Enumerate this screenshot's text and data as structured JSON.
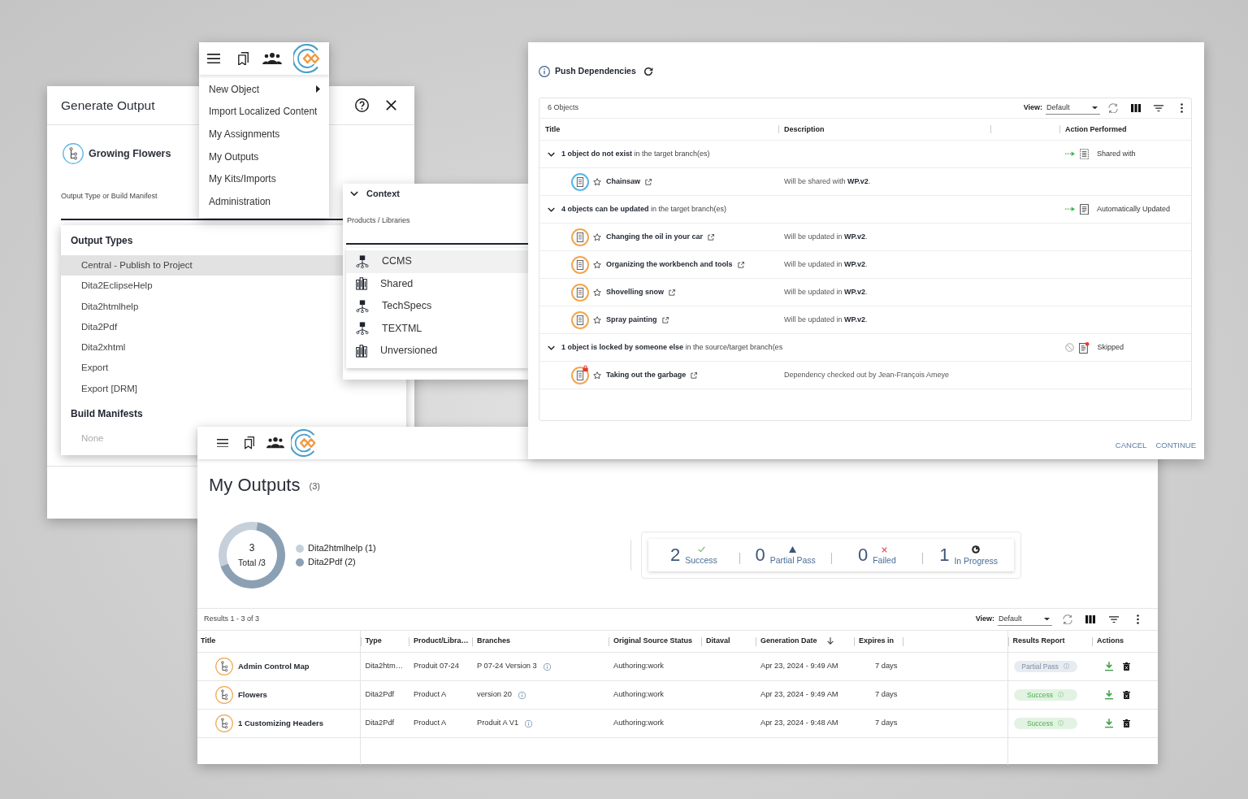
{
  "generate_output": {
    "title": "Generate Output",
    "object_title": "Growing Flowers",
    "field_label": "Output Type or Build Manifest",
    "sections": [
      {
        "heading": "Output Types",
        "items": [
          {
            "label": "Central - Publish to Project",
            "selected": true,
            "disabled": false
          },
          {
            "label": "Dita2EclipseHelp",
            "selected": false,
            "disabled": false
          },
          {
            "label": "Dita2htmlhelp",
            "selected": false,
            "disabled": false
          },
          {
            "label": "Dita2Pdf",
            "selected": false,
            "disabled": false
          },
          {
            "label": "Dita2xhtml",
            "selected": false,
            "disabled": false
          },
          {
            "label": "Export",
            "selected": false,
            "disabled": false
          },
          {
            "label": "Export [DRM]",
            "selected": false,
            "disabled": false
          }
        ]
      },
      {
        "heading": "Build Manifests",
        "items": [
          {
            "label": "None",
            "selected": false,
            "disabled": true
          }
        ]
      }
    ]
  },
  "main_menu": {
    "items": [
      {
        "label": "New Object",
        "submenu": true
      },
      {
        "label": "Import Localized Content",
        "submenu": false
      },
      {
        "label": "My Assignments",
        "submenu": false
      },
      {
        "label": "My Outputs",
        "submenu": false
      },
      {
        "label": "My Kits/Imports",
        "submenu": false
      },
      {
        "label": "Administration",
        "submenu": false
      }
    ]
  },
  "context_panel": {
    "title": "Context",
    "expanded": true,
    "field_label": "Products / Libraries",
    "items": [
      {
        "label": "CCMS",
        "kind": "product",
        "selected": true
      },
      {
        "label": "Shared",
        "kind": "library",
        "selected": false
      },
      {
        "label": "TechSpecs",
        "kind": "product",
        "selected": false
      },
      {
        "label": "TEXTML",
        "kind": "product",
        "selected": false
      },
      {
        "label": "Unversioned",
        "kind": "library",
        "selected": false
      }
    ]
  },
  "push_dependencies": {
    "title": "Push Dependencies",
    "count_label": "6 Objects",
    "view_label": "View:",
    "view_value": "Default",
    "columns": [
      "Title",
      "Description",
      "Action Performed"
    ],
    "groups": [
      {
        "heading": "**1 object do not exist** in the target branch(es)",
        "expanded": true,
        "kind": "shared",
        "action": "Shared with",
        "items": [
          {
            "title": "Chainsaw",
            "description": "Will be shared with **WP.v2**.",
            "color": "#5bb5e6",
            "locked": false
          }
        ]
      },
      {
        "heading": "**4 objects can be updated** in the target branch(es)",
        "expanded": true,
        "kind": "updated",
        "action": "Automatically Updated",
        "items": [
          {
            "title": "Changing the oil in your car",
            "description": "Will be updated in **WP.v2**.",
            "color": "#f0a752",
            "locked": false
          },
          {
            "title": "Organizing the workbench and tools",
            "description": "Will be updated in **WP.v2**.",
            "color": "#f0a752",
            "locked": false
          },
          {
            "title": "Shovelling snow",
            "description": "Will be updated in **WP.v2**.",
            "color": "#f0a752",
            "locked": false
          },
          {
            "title": "Spray painting",
            "description": "Will be updated in **WP.v2**.",
            "color": "#f0a752",
            "locked": false
          }
        ]
      },
      {
        "heading": "**1 object is locked by someone else** in the source/target branch(es",
        "expanded": true,
        "kind": "skipped",
        "action": "Skipped",
        "items": [
          {
            "title": "Taking out the garbage",
            "description": "Dependency checked out by Jean-François Ameye",
            "color": "#f0a752",
            "locked": true
          }
        ]
      }
    ],
    "buttons": [
      "CANCEL",
      "CONTINUE"
    ]
  },
  "my_outputs": {
    "title": "My Outputs",
    "count": "(3)",
    "donut": {
      "center_value": "3",
      "center_label": "Total /3",
      "slices": [
        {
          "color": "#c6d0da"
        },
        {
          "color": "#8ca0b4"
        }
      ],
      "chart_data": {
        "type": "donut",
        "categories": [
          "Dita2htmlhelp (1)",
          "Dita2Pdf (2)"
        ],
        "values": [
          1,
          2
        ]
      }
    },
    "summary": [
      {
        "kind": "success",
        "count": "2",
        "label": "Success"
      },
      {
        "kind": "partial",
        "count": "0",
        "label": "Partial Pass"
      },
      {
        "kind": "failed",
        "count": "0",
        "label": "Failed"
      },
      {
        "kind": "progress",
        "count": "1",
        "label": "In Progress"
      }
    ],
    "results_label": "Results 1 - 3 of 3",
    "view_label": "View:",
    "view_value": "Default",
    "columns": [
      {
        "label": "Title",
        "sorted": false
      },
      {
        "label": "Type",
        "sorted": false
      },
      {
        "label": "Product/Libra…",
        "sorted": false
      },
      {
        "label": "Branches",
        "sorted": false
      },
      {
        "label": "Original Source Status",
        "sorted": false
      },
      {
        "label": "Ditaval",
        "sorted": false
      },
      {
        "label": "Generation Date",
        "sorted": true
      },
      {
        "label": "Expires in",
        "sorted": false
      },
      {
        "label": "Results Report",
        "sorted": false
      },
      {
        "label": "Actions",
        "sorted": false
      }
    ],
    "rows": [
      {
        "title": "Admin Control Map",
        "type": "Dita2htm…",
        "product": "Produit 07-24",
        "branch": "P 07-24 Version 3",
        "source_status": "Authoring:work",
        "generation_date": "Apr 23, 2024 - 9:49 AM",
        "expires": "7 days",
        "report": {
          "label": "Partial Pass",
          "kind": "partial"
        }
      },
      {
        "title": "Flowers",
        "type": "Dita2Pdf",
        "product": "Product A",
        "branch": "version 20",
        "source_status": "Authoring:work",
        "generation_date": "Apr 23, 2024 - 9:49 AM",
        "expires": "7 days",
        "report": {
          "label": "Success",
          "kind": "success"
        }
      },
      {
        "title": "1 Customizing Headers",
        "type": "Dita2Pdf",
        "product": "Product A",
        "branch": "Produit A V1",
        "source_status": "Authoring:work",
        "generation_date": "Apr 23, 2024 - 9:48 AM",
        "expires": "7 days",
        "report": {
          "label": "Success",
          "kind": "success"
        }
      }
    ]
  }
}
